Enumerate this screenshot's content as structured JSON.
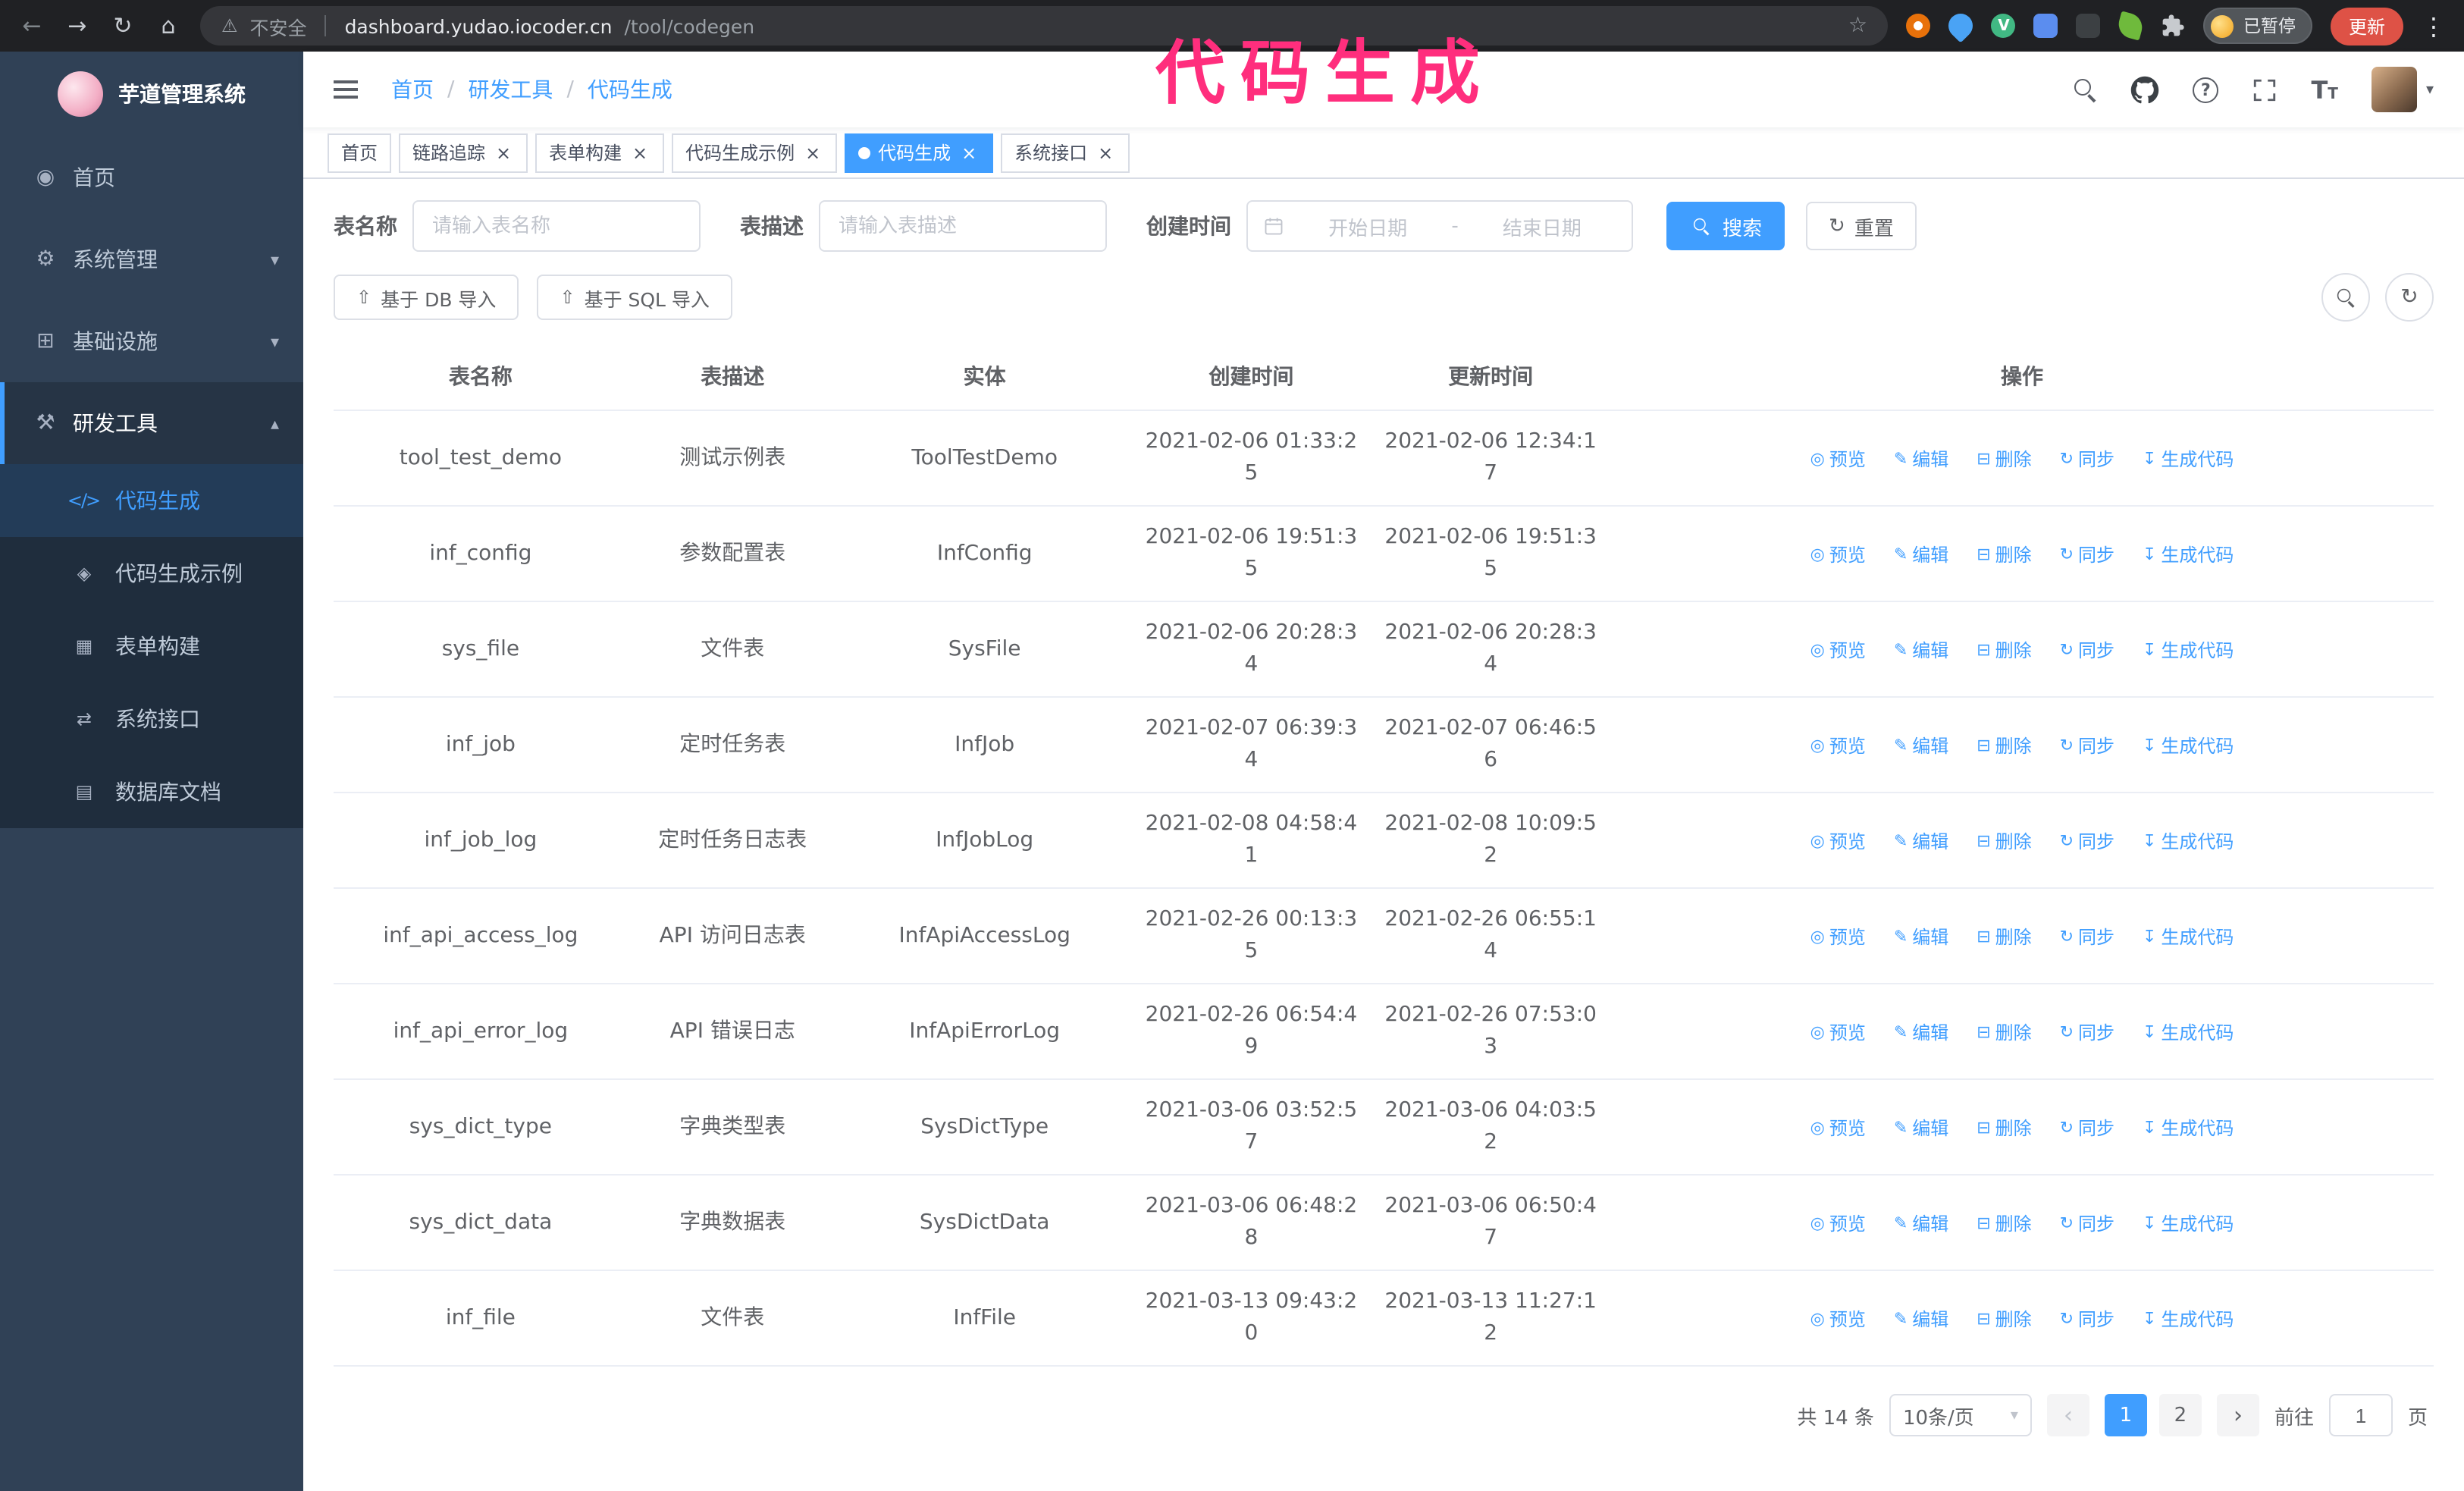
{
  "browser": {
    "security_label": "不安全",
    "url_host": "dashboard.yudao.iocoder.cn",
    "url_path": "/tool/codegen",
    "paused_badge": "已暂停",
    "update_button": "更新"
  },
  "annotation": {
    "text": "代码生成",
    "color": "#ff2e7d"
  },
  "colors": {
    "accent": "#409eff",
    "sidebar_bg": "#304156",
    "submenu_bg": "#1f2d3d",
    "active_tab_bg": "#409eff",
    "update_button_bg": "#de5246",
    "annotation": "#ff2e7d"
  },
  "sidebar": {
    "app_title": "芋道管理系统",
    "items": [
      {
        "label": "首页",
        "icon": "◉",
        "icon_name": "dashboard-icon",
        "expandable": false
      },
      {
        "label": "系统管理",
        "icon": "⚙",
        "icon_name": "gear-icon",
        "expandable": true
      },
      {
        "label": "基础设施",
        "icon": "⊞",
        "icon_name": "infrastructure-icon",
        "expandable": true
      },
      {
        "label": "研发工具",
        "icon": "⚒",
        "icon_name": "dev-tools-icon",
        "expandable": true,
        "expanded": true
      }
    ],
    "sub_items": [
      {
        "label": "代码生成",
        "icon": "</>",
        "icon_name": "code-icon",
        "active": true
      },
      {
        "label": "代码生成示例",
        "icon": "◈",
        "icon_name": "example-badge-icon"
      },
      {
        "label": "表单构建",
        "icon": "▦",
        "icon_name": "form-builder-icon"
      },
      {
        "label": "系统接口",
        "icon": "⇄",
        "icon_name": "api-icon"
      },
      {
        "label": "数据库文档",
        "icon": "▤",
        "icon_name": "database-doc-icon"
      }
    ]
  },
  "header": {
    "breadcrumb": [
      "首页",
      "研发工具",
      "代码生成"
    ]
  },
  "tabs": [
    {
      "label": "首页",
      "closable": false
    },
    {
      "label": "链路追踪",
      "closable": true
    },
    {
      "label": "表单构建",
      "closable": true
    },
    {
      "label": "代码生成示例",
      "closable": true
    },
    {
      "label": "代码生成",
      "closable": true,
      "active": true
    },
    {
      "label": "系统接口",
      "closable": true
    }
  ],
  "filters": {
    "table_name_label": "表名称",
    "table_name_placeholder": "请输入表名称",
    "table_desc_label": "表描述",
    "table_desc_placeholder": "请输入表描述",
    "create_time_label": "创建时间",
    "date_start_placeholder": "开始日期",
    "date_separator": "-",
    "date_end_placeholder": "结束日期",
    "search_button": "搜索",
    "reset_button": "重置"
  },
  "toolbar": {
    "import_db_button": "基于 DB 导入",
    "import_sql_button": "基于 SQL 导入"
  },
  "table": {
    "columns": [
      "表名称",
      "表描述",
      "实体",
      "创建时间",
      "更新时间",
      "操作"
    ],
    "row_actions": [
      {
        "label": "预览",
        "icon": "◎",
        "icon_name": "eye-icon"
      },
      {
        "label": "编辑",
        "icon": "✎",
        "icon_name": "edit-pencil-icon"
      },
      {
        "label": "删除",
        "icon": "⊟",
        "icon_name": "delete-trash-icon"
      },
      {
        "label": "同步",
        "icon": "↻",
        "icon_name": "sync-icon"
      },
      {
        "label": "生成代码",
        "icon": "↧",
        "icon_name": "generate-download-icon"
      }
    ],
    "rows": [
      {
        "name": "tool_test_demo",
        "desc": "测试示例表",
        "entity": "ToolTestDemo",
        "created": "2021-02-06 01:33:25",
        "updated": "2021-02-06 12:34:17"
      },
      {
        "name": "inf_config",
        "desc": "参数配置表",
        "entity": "InfConfig",
        "created": "2021-02-06 19:51:35",
        "updated": "2021-02-06 19:51:35"
      },
      {
        "name": "sys_file",
        "desc": "文件表",
        "entity": "SysFile",
        "created": "2021-02-06 20:28:34",
        "updated": "2021-02-06 20:28:34"
      },
      {
        "name": "inf_job",
        "desc": "定时任务表",
        "entity": "InfJob",
        "created": "2021-02-07 06:39:34",
        "updated": "2021-02-07 06:46:56"
      },
      {
        "name": "inf_job_log",
        "desc": "定时任务日志表",
        "entity": "InfJobLog",
        "created": "2021-02-08 04:58:41",
        "updated": "2021-02-08 10:09:52"
      },
      {
        "name": "inf_api_access_log",
        "desc": "API 访问日志表",
        "entity": "InfApiAccessLog",
        "created": "2021-02-26 00:13:35",
        "updated": "2021-02-26 06:55:14"
      },
      {
        "name": "inf_api_error_log",
        "desc": "API 错误日志",
        "entity": "InfApiErrorLog",
        "created": "2021-02-26 06:54:49",
        "updated": "2021-02-26 07:53:03"
      },
      {
        "name": "sys_dict_type",
        "desc": "字典类型表",
        "entity": "SysDictType",
        "created": "2021-03-06 03:52:57",
        "updated": "2021-03-06 04:03:52"
      },
      {
        "name": "sys_dict_data",
        "desc": "字典数据表",
        "entity": "SysDictData",
        "created": "2021-03-06 06:48:28",
        "updated": "2021-03-06 06:50:47"
      },
      {
        "name": "inf_file",
        "desc": "文件表",
        "entity": "InfFile",
        "created": "2021-03-13 09:43:20",
        "updated": "2021-03-13 11:27:12"
      }
    ]
  },
  "pagination": {
    "total_text": "共 14 条",
    "page_size": "10条/页",
    "pages": [
      {
        "label": "1",
        "active": true
      },
      {
        "label": "2",
        "active": false
      }
    ],
    "goto_label": "前往",
    "goto_value": "1",
    "goto_suffix": "页"
  }
}
